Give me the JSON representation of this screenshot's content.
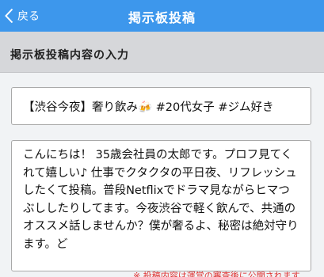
{
  "header": {
    "back_label": "戻る",
    "title": "掲示板投稿"
  },
  "section": {
    "heading": "掲示板投稿内容の入力"
  },
  "form": {
    "title_value": "【渋谷今夜】奢り飲み🍻 #20代女子 #ジム好き",
    "body_value": "こんにちは！ 35歳会社員の太郎です。プロフ見てくれて嬉しい♪ 仕事でクタクタの平日夜、リフレッシュしたくて投稿。普段Netflixでドラマ見ながらヒマつぶししたりしてます。今夜渋谷で軽く飲んで、共通のオススメ話しませんか？僕が奢るよ、秘密は絶対守ります。ど"
  },
  "notice": {
    "text": "※ 投稿内容は運営の審査後に公開されます"
  },
  "colors": {
    "header_bg": "#3d97ec",
    "section_bg": "#d6d7da",
    "notice": "#e03131"
  }
}
